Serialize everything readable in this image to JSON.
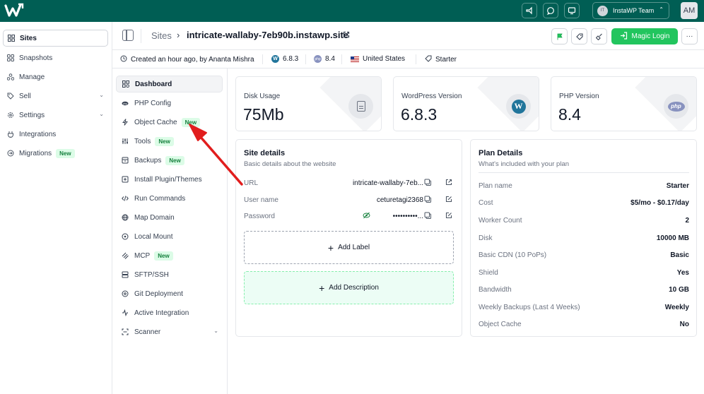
{
  "topbar": {
    "team_avatar": "IT",
    "team_name": "InstaWP Team",
    "user_initials": "AM"
  },
  "sidebar": {
    "items": [
      {
        "label": "Sites",
        "icon": "sites-icon",
        "active": true
      },
      {
        "label": "Snapshots",
        "icon": "snapshots-icon"
      },
      {
        "label": "Manage",
        "icon": "manage-icon"
      },
      {
        "label": "Sell",
        "icon": "sell-icon",
        "chevron": true
      },
      {
        "label": "Settings",
        "icon": "settings-icon",
        "chevron": true
      },
      {
        "label": "Integrations",
        "icon": "integrations-icon"
      },
      {
        "label": "Migrations",
        "icon": "migrations-icon",
        "badge": "New"
      }
    ]
  },
  "header": {
    "breadcrumb_root": "Sites",
    "breadcrumb_sep": "›",
    "site_name": "intricate-wallaby-7eb90b.instawp.site",
    "magic_login": "Magic Login",
    "more": "···"
  },
  "infobar": {
    "created": "Created an hour ago, by Ananta Mishra",
    "wp_version": "6.8.3",
    "php_version": "8.4",
    "country": "United States",
    "plan": "Starter"
  },
  "site_menu": {
    "items": [
      {
        "label": "Dashboard",
        "icon": "dashboard-icon",
        "active": true
      },
      {
        "label": "PHP Config",
        "icon": "php-config-icon"
      },
      {
        "label": "Object Cache",
        "icon": "object-cache-icon",
        "badge": "New"
      },
      {
        "label": "Tools",
        "icon": "tools-icon",
        "badge": "New"
      },
      {
        "label": "Backups",
        "icon": "backups-icon",
        "badge": "New"
      },
      {
        "label": "Install Plugin/Themes",
        "icon": "plugin-icon"
      },
      {
        "label": "Run Commands",
        "icon": "terminal-icon"
      },
      {
        "label": "Map Domain",
        "icon": "globe-icon"
      },
      {
        "label": "Local Mount",
        "icon": "mount-icon"
      },
      {
        "label": "MCP",
        "icon": "mcp-icon",
        "badge": "New"
      },
      {
        "label": "SFTP/SSH",
        "icon": "sftp-icon"
      },
      {
        "label": "Git Deployment",
        "icon": "git-icon"
      },
      {
        "label": "Active Integration",
        "icon": "integration-icon"
      },
      {
        "label": "Scanner",
        "icon": "scanner-icon",
        "chevron": true
      }
    ]
  },
  "stats": [
    {
      "label": "Disk Usage",
      "value": "75Mb",
      "icon": "document-icon"
    },
    {
      "label": "WordPress Version",
      "value": "6.8.3",
      "icon": "wordpress-icon"
    },
    {
      "label": "PHP Version",
      "value": "8.4",
      "icon": "php-icon"
    }
  ],
  "site_details": {
    "title": "Site details",
    "subtitle": "Basic details about the website",
    "rows": [
      {
        "label": "URL",
        "value": "intricate-wallaby-7eb..."
      },
      {
        "label": "User name",
        "value": "ceturetagi2368"
      },
      {
        "label": "Password",
        "value": "••••••••••..."
      }
    ],
    "add_label": "Add Label",
    "add_description": "Add Description"
  },
  "plan_details": {
    "title": "Plan Details",
    "subtitle": "What's included with your plan",
    "rows": [
      {
        "label": "Plan name",
        "value": "Starter"
      },
      {
        "label": "Cost",
        "value": "$5/mo - $0.17/day"
      },
      {
        "label": "Worker Count",
        "value": "2"
      },
      {
        "label": "Disk",
        "value": "10000 MB"
      },
      {
        "label": "Basic CDN (10 PoPs)",
        "value": "Basic"
      },
      {
        "label": "Shield",
        "value": "Yes"
      },
      {
        "label": "Bandwidth",
        "value": "10 GB"
      },
      {
        "label": "Weekly Backups (Last 4 Weeks)",
        "value": "Weekly"
      },
      {
        "label": "Object Cache",
        "value": "No"
      }
    ]
  },
  "colors": {
    "topbar": "#005e54",
    "primary_button": "#22c55e",
    "badge_bg": "#dcfce7",
    "badge_text": "#15803d",
    "annotation_arrow": "#e11d1d"
  }
}
